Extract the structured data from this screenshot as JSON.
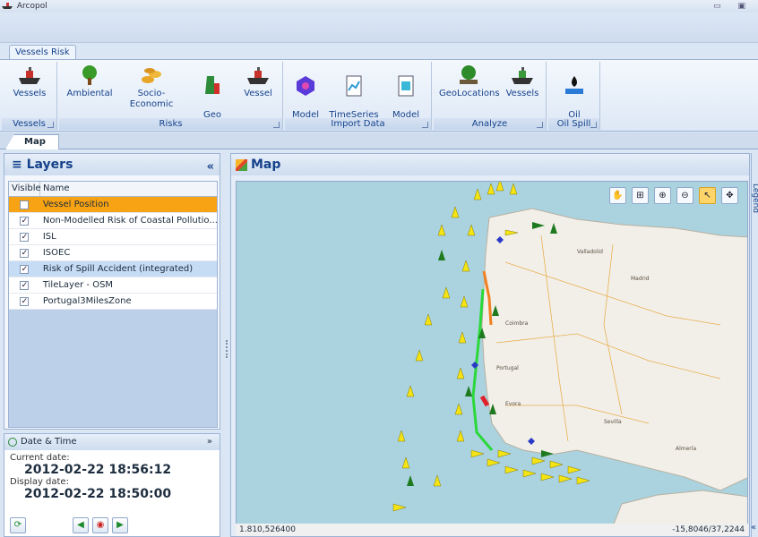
{
  "window": {
    "title": "Arcopol"
  },
  "ribbon": {
    "tab": "Vessels Risk",
    "groups": [
      {
        "label": "Vessels",
        "buttons": [
          {
            "label": "Vessels"
          }
        ]
      },
      {
        "label": "Risks",
        "buttons": [
          {
            "label": "Ambiental"
          },
          {
            "label": "Socio-Economic"
          },
          {
            "label": "Geo\nLocation"
          },
          {
            "label": "Vessel"
          }
        ]
      },
      {
        "label": "Import Data",
        "buttons": [
          {
            "label": "Model\nDomain"
          },
          {
            "label": "TimeSeries\nWatcher"
          },
          {
            "label": "Model\nWatcher"
          }
        ]
      },
      {
        "label": "Analyze",
        "buttons": [
          {
            "label": "GeoLocations"
          },
          {
            "label": "Vessels"
          }
        ]
      },
      {
        "label": "Oil Spill",
        "buttons": [
          {
            "label": "Oil\nSpils"
          }
        ]
      }
    ]
  },
  "doc_tab": "Map",
  "layers_panel": {
    "title": "Layers",
    "columns": [
      "Visible",
      "Name"
    ],
    "rows": [
      {
        "name": "Vessel Position",
        "visible": false
      },
      {
        "name": "Non-Modelled Risk of Coastal Pollutio...",
        "visible": true
      },
      {
        "name": "ISL",
        "visible": true
      },
      {
        "name": "ISOEC",
        "visible": true
      },
      {
        "name": "Risk of Spill Accident (integrated)",
        "visible": true
      },
      {
        "name": "TileLayer - OSM",
        "visible": true
      },
      {
        "name": "Portugal3MilesZone",
        "visible": true
      }
    ]
  },
  "datetime": {
    "title": "Date & Time",
    "current_label": "Current date:",
    "current_value": "2012-02-22 18:56:12",
    "display_label": "Display date:",
    "display_value": "2012-02-22 18:50:00"
  },
  "map_panel": {
    "title": "Map",
    "status_left": "1.810,526400",
    "status_right": "-15,8046/37,2244"
  },
  "legend": {
    "label": "Legend"
  },
  "colors": {
    "accent": "#15428b",
    "selected_row": "#f8a314",
    "vessel_yellow": "#f4e414",
    "vessel_green": "#1f7a1f",
    "sea": "#aad3df",
    "land": "#f2efe9"
  }
}
